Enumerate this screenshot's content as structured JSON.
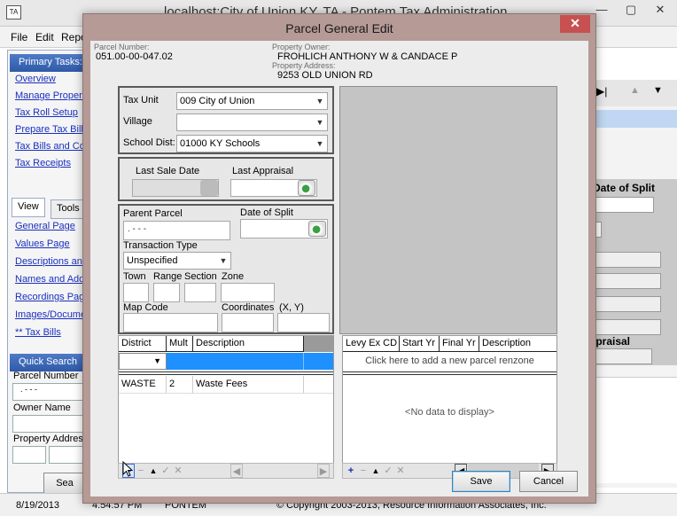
{
  "main_window": {
    "app_icon": "TA",
    "title": "localhost:City of Union KY, TA - Pontem Tax Administration",
    "controls": [
      "—",
      "▢",
      "✕"
    ]
  },
  "menu": [
    "File",
    "Edit",
    "Repo"
  ],
  "sidebar": {
    "primary_tasks_header": "Primary Tasks:",
    "primary_tasks": [
      "Overview",
      "Manage Property",
      "Tax Roll Setup",
      "Prepare Tax Bills",
      "Tax Bills and Co",
      "Tax Receipts"
    ],
    "tabs": [
      "View",
      "Tools"
    ],
    "view_links": [
      "General Page",
      "Values Page",
      "Descriptions and",
      "Names and Addr",
      "Recordings Page",
      "Images/Docume",
      "** Tax Bills"
    ],
    "quick_search_header": "Quick Search",
    "parcel_number_label": "Parcel Number",
    "parcel_number_value": ". - - -",
    "owner_name_label": "Owner Name",
    "property_address_label": "Property Address",
    "search_button": "Sea"
  },
  "right_panel": {
    "date_of_split_label": "Date of Split",
    "appraisal_label": "ppraisal"
  },
  "statusbar": {
    "date": "8/19/2013",
    "time": "4:54:57 PM",
    "product": "PONTEM",
    "copyright": "© Copyright 2003-2013, Resource Information Associates, Inc."
  },
  "dialog": {
    "title": "Parcel General Edit",
    "close": "✕",
    "parcel_number_label": "Parcel Number:",
    "parcel_number": "051.00-00-047.02",
    "property_owner_label": "Property Owner:",
    "property_owner": "FROHLICH ANTHONY W & CANDACE P",
    "property_address_label": "Property Address:",
    "property_address": "9253 OLD UNION RD",
    "tax_unit_label": "Tax Unit",
    "tax_unit_value": "009   City of Union",
    "village_label": "Village",
    "village_value": "",
    "school_dist_label": "School Dist:",
    "school_dist_value": "01000   KY Schools",
    "last_sale_date_label": "Last Sale Date",
    "last_appraisal_label": "Last Appraisal",
    "parent_parcel_label": "Parent Parcel",
    "parent_parcel_value": ". - - -",
    "date_of_split_label": "Date of Split",
    "transaction_type_label": "Transaction Type",
    "transaction_type_value": "Unspecified",
    "town_label": "Town",
    "range_label": "Range",
    "section_label": "Section",
    "zone_label": "Zone",
    "map_code_label": "Map Code",
    "coordinates_label": "Coordinates",
    "coordinates_xy_label": "(X, Y)",
    "district_grid": {
      "columns": [
        "District",
        "Mult",
        "Description"
      ],
      "rows": [
        {
          "district": "WASTE",
          "mult": "2",
          "description": "Waste Fees"
        }
      ]
    },
    "renzone_grid": {
      "columns": [
        "Levy Ex CD",
        "Start Yr",
        "Final Yr",
        "Description"
      ],
      "add_new_text": "Click here to add a new parcel renzone",
      "empty_text": "<No data to display>"
    },
    "nav_buttons": [
      "+",
      "−",
      "▲",
      "✓",
      "✕"
    ],
    "save_button": "Save",
    "cancel_button": "Cancel"
  }
}
